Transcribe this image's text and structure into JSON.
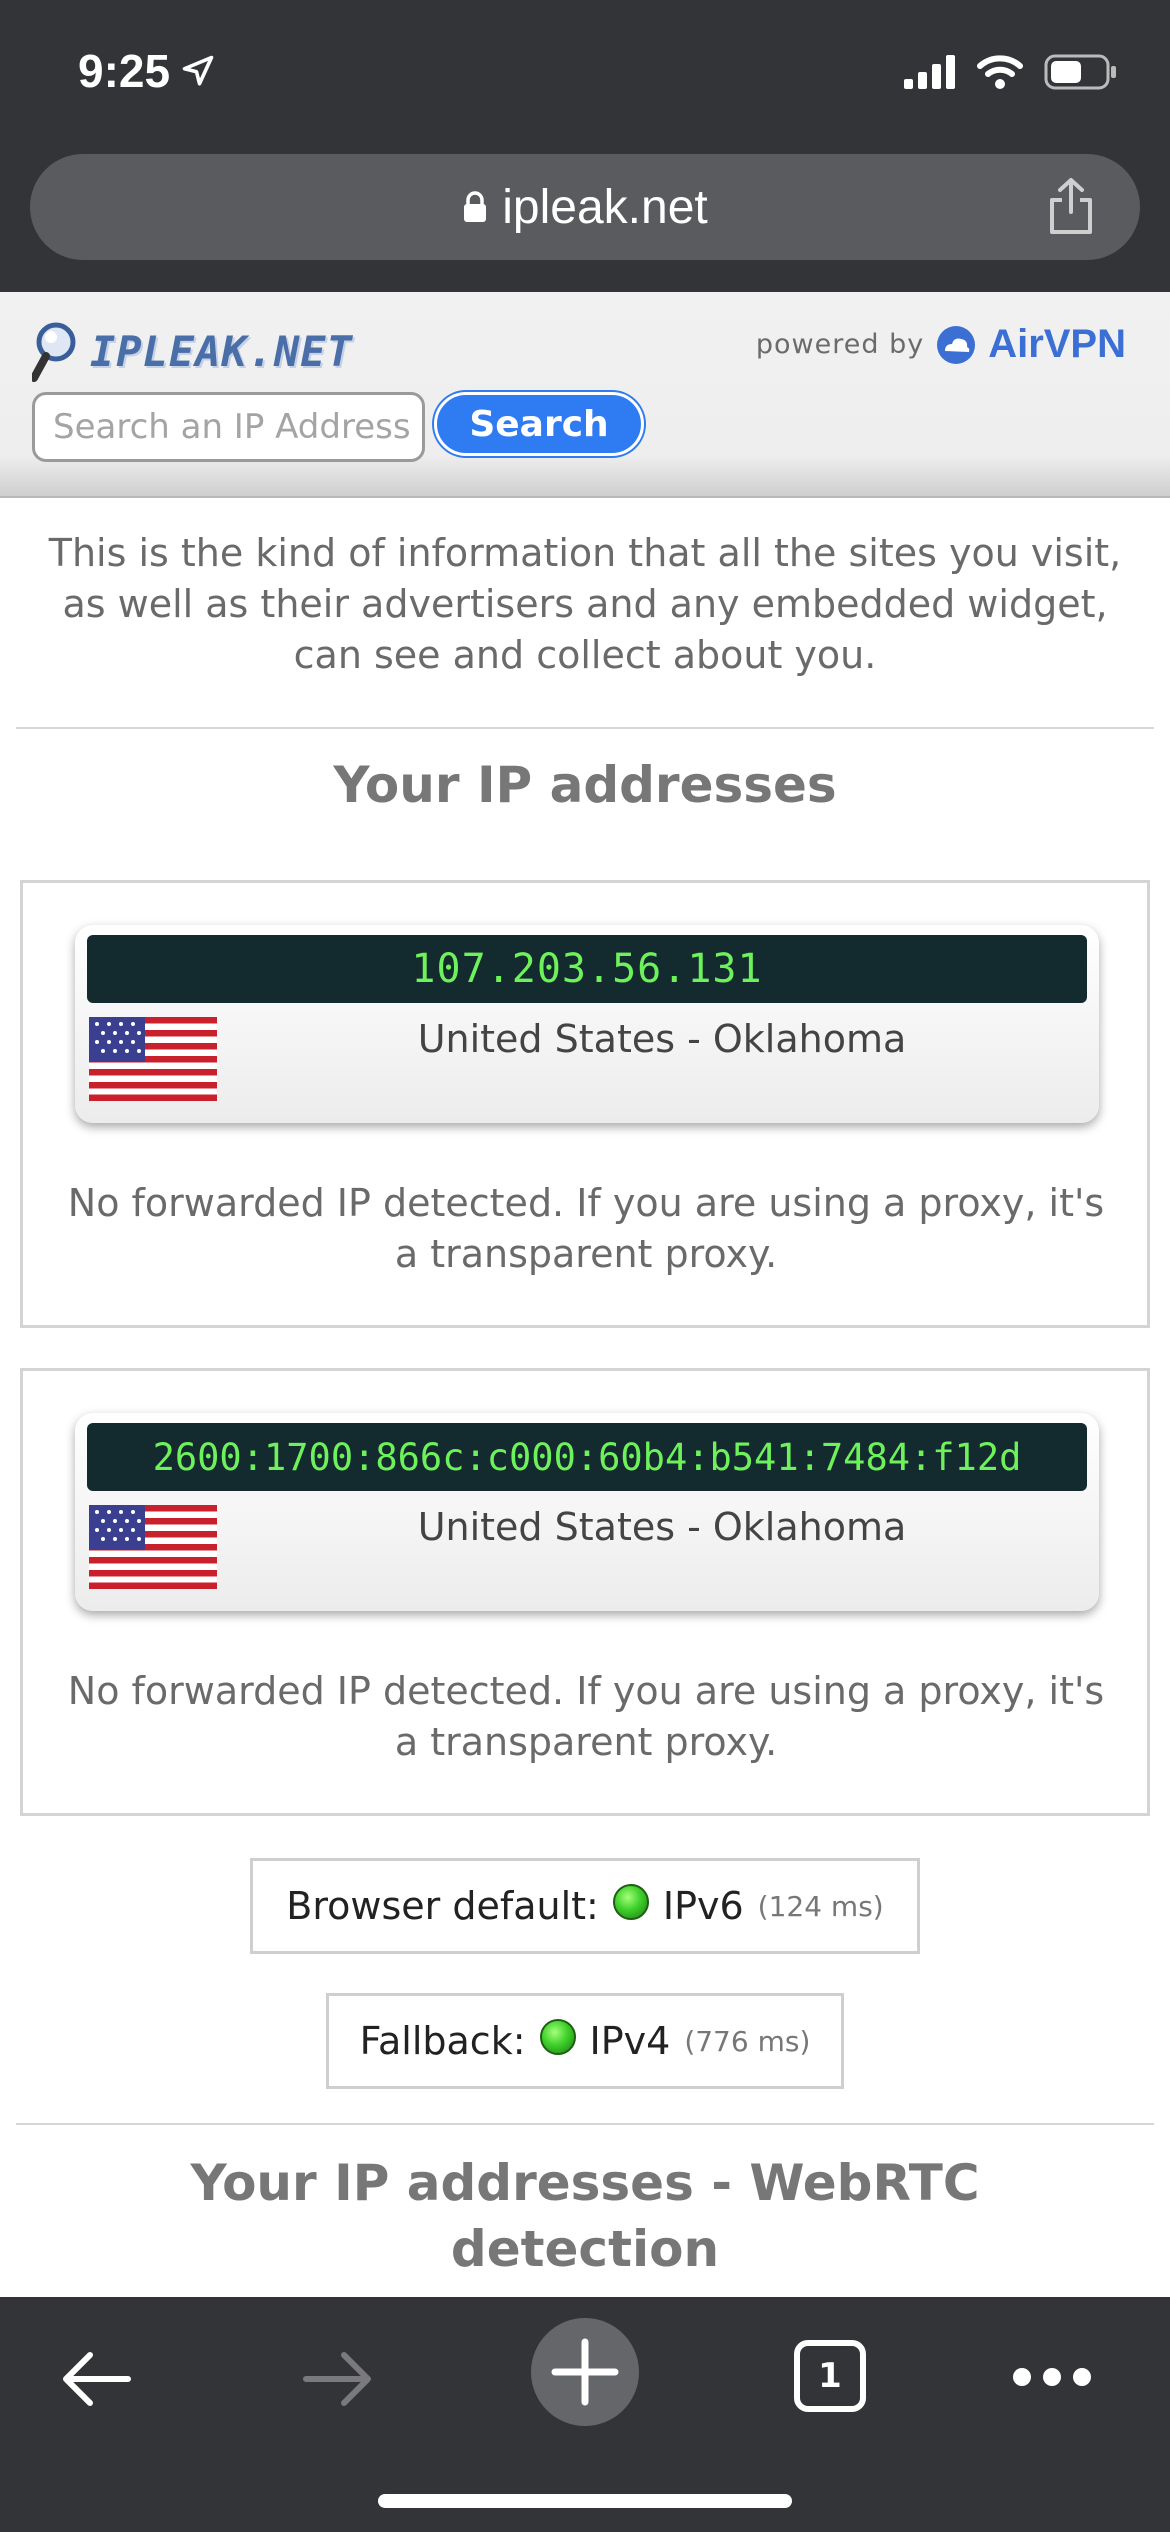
{
  "status_bar": {
    "time": "9:25"
  },
  "browser": {
    "url": "ipleak.net"
  },
  "site": {
    "logo_text": "IPLEAK.NET",
    "powered_by": "powered by",
    "brand": "AirVPN",
    "search_placeholder": "Search an IP Address",
    "search_button": "Search"
  },
  "intro": "This is the kind of information that all the sites you visit, as well as their advertisers and any embedded widget, can see and collect about you.",
  "ip_section": {
    "title": "Your IP addresses",
    "entries": [
      {
        "ip": "107.203.56.131",
        "location": "United States - Oklahoma",
        "forwarded_note": "No forwarded IP detected. If you are using a proxy, it's a transparent proxy."
      },
      {
        "ip": "2600:1700:866c:c000:60b4:b541:7484:f12d",
        "location": "United States - Oklahoma",
        "forwarded_note": "No forwarded IP detected. If you are using a proxy, it's a transparent proxy."
      }
    ],
    "browser_default": {
      "label": "Browser default:",
      "proto": "IPv6",
      "latency": "(124 ms)"
    },
    "fallback": {
      "label": "Fallback:",
      "proto": "IPv4",
      "latency": "(776 ms)"
    }
  },
  "webrtc_section": {
    "title": "Your IP addresses - WebRTC detection"
  },
  "toolbar": {
    "tab_count": "1"
  },
  "colors": {
    "accent": "#2f7bf2",
    "ip_text": "#6ef25b",
    "chrome": "#333437"
  }
}
